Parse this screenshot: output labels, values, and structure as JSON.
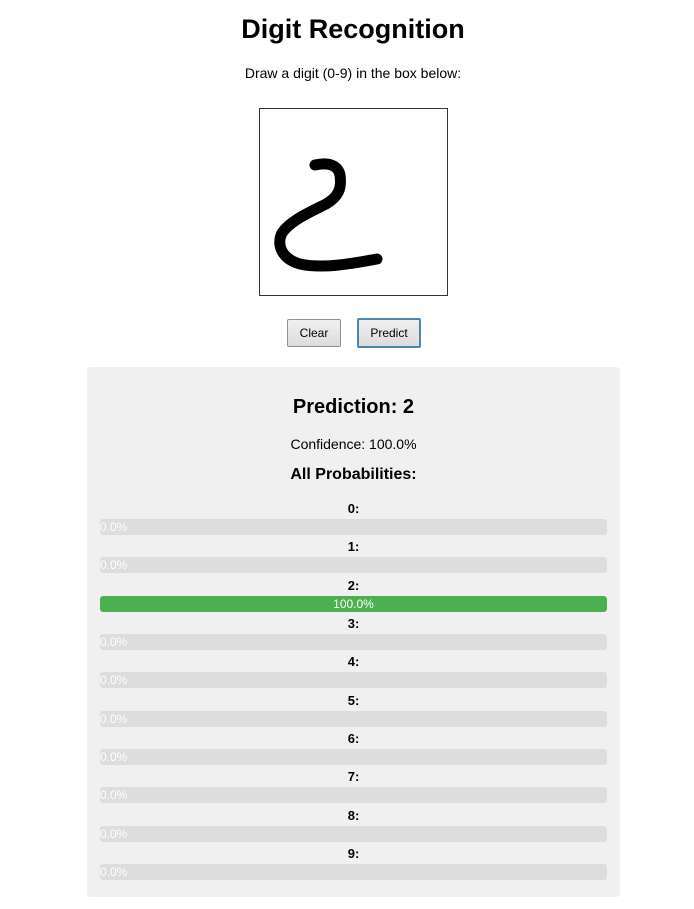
{
  "header": {
    "title": "Digit Recognition",
    "instructions": "Draw a digit (0-9) in the box below:"
  },
  "canvas": {
    "stroke_color": "#000000",
    "background_color": "#ffffff",
    "drawn_digit_description": "2"
  },
  "buttons": {
    "clear_label": "Clear",
    "predict_label": "Predict"
  },
  "results": {
    "prediction_text": "Prediction: 2",
    "confidence_text": "Confidence: 100.0%",
    "probabilities_heading": "All Probabilities:",
    "bar_color": "#4caf50",
    "track_color": "#dddddd",
    "probabilities": [
      {
        "label": "0:",
        "value": 0.0,
        "text": "0.0%"
      },
      {
        "label": "1:",
        "value": 0.0,
        "text": "0.0%"
      },
      {
        "label": "2:",
        "value": 1.0,
        "text": "100.0%"
      },
      {
        "label": "3:",
        "value": 0.0,
        "text": "0.0%"
      },
      {
        "label": "4:",
        "value": 0.0,
        "text": "0.0%"
      },
      {
        "label": "5:",
        "value": 0.0,
        "text": "0.0%"
      },
      {
        "label": "6:",
        "value": 0.0,
        "text": "0.0%"
      },
      {
        "label": "7:",
        "value": 0.0,
        "text": "0.0%"
      },
      {
        "label": "8:",
        "value": 0.0,
        "text": "0.0%"
      },
      {
        "label": "9:",
        "value": 0.0,
        "text": "0.0%"
      }
    ]
  }
}
